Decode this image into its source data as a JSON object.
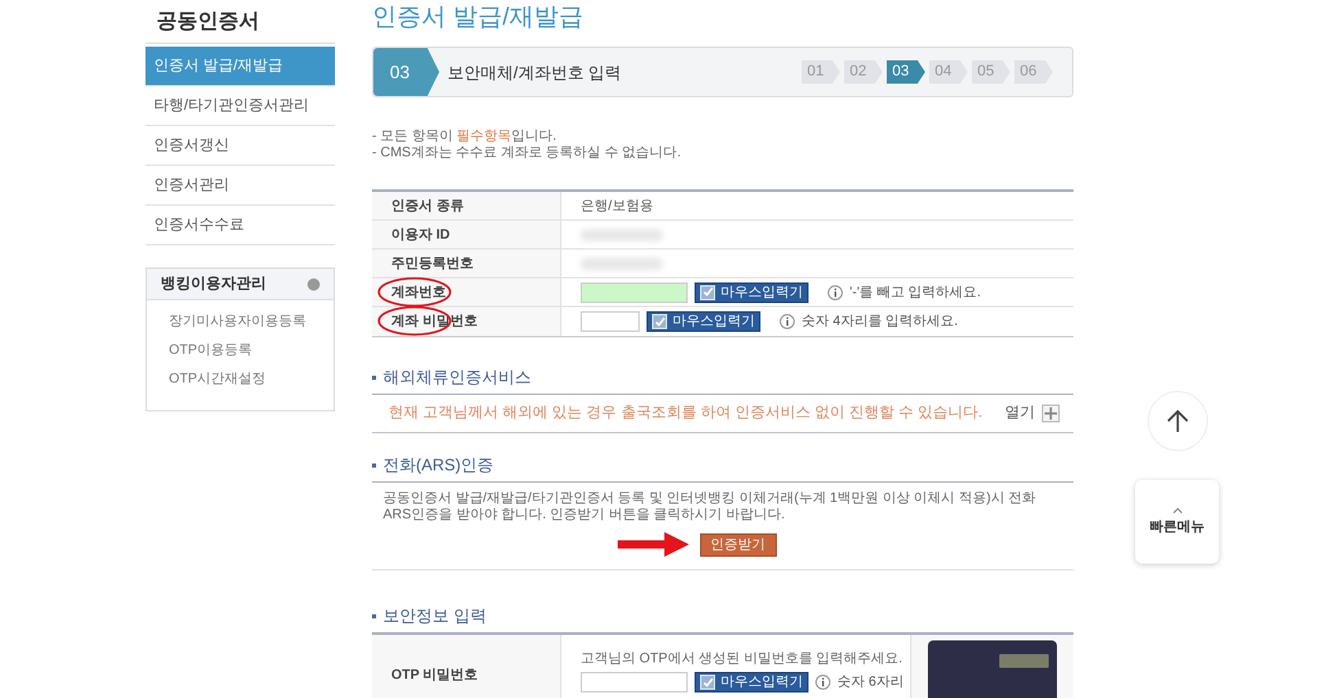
{
  "sidebar": {
    "title": "공동인증서",
    "items": [
      {
        "label": "인증서 발급/재발급",
        "selected": true
      },
      {
        "label": "타행/타기관인증서관리",
        "selected": false
      },
      {
        "label": "인증서갱신",
        "selected": false
      },
      {
        "label": "인증서관리",
        "selected": false
      },
      {
        "label": "인증서수수료",
        "selected": false
      }
    ],
    "box": {
      "title": "뱅킹이용자관리",
      "links": [
        "장기미사용자이용등록",
        "OTP이용등록",
        "OTP시간재설정"
      ]
    }
  },
  "page_title": "인증서 발급/재발급",
  "step_bar": {
    "current_number": "03",
    "current_label": "보안매체/계좌번호 입력",
    "steps": [
      {
        "label": "01",
        "selected": false
      },
      {
        "label": "02",
        "selected": false
      },
      {
        "label": "03",
        "selected": true
      },
      {
        "label": "04",
        "selected": false
      },
      {
        "label": "05",
        "selected": false
      },
      {
        "label": "06",
        "selected": false
      }
    ]
  },
  "notes": [
    [
      {
        "text": "- 모든 항목이 ",
        "highlight": false
      },
      {
        "text": "필수항목",
        "highlight": true
      },
      {
        "text": "입니다.",
        "highlight": false
      }
    ],
    [
      {
        "text": "- CMS계좌는 수수료 계좌로 등록하실 수 없습니다.",
        "highlight": false
      }
    ]
  ],
  "form": [
    {
      "label": "인증서 종류",
      "kind": "text",
      "value": "은행/보험용",
      "annotated": false
    },
    {
      "label": "이용자 ID",
      "kind": "hidden",
      "annotated": false
    },
    {
      "label": "주민등록번호",
      "kind": "hidden",
      "annotated": false
    },
    {
      "label": "계좌번호",
      "kind": "input",
      "wide": true,
      "active": true,
      "keypad": "마우스입력기",
      "keypad_checked": true,
      "hint": "'-'를 빼고 입력하세요.",
      "annotated": true
    },
    {
      "label": "계좌 비밀번호",
      "kind": "input",
      "wide": false,
      "active": false,
      "keypad": "마우스입력기",
      "keypad_checked": true,
      "hint": "숫자 4자리를 입력하세요.",
      "annotated": true
    }
  ],
  "overseas": {
    "heading": "해외체류인증서비스",
    "message": "현재 고객님께서 해외에 있는 경우 출국조회를 하여 인증서비스 없이 진행할 수 있습니다.",
    "toggle_label": "열기",
    "expanded": false
  },
  "ars": {
    "heading": "전화(ARS)인증",
    "text": "공동인증서 발급/재발급/타기관인증서 등록 및 인터넷뱅킹 이체거래(누계 1백만원 이상 이체시 적용)시 전화ARS인증을 받아야 합니다. 인증받기 버튼을 클릭하시기 바랍니다.",
    "button": "인증받기"
  },
  "security": {
    "heading": "보안정보 입력",
    "label": "OTP 비밀번호",
    "instruction": "고객님의 OTP에서 생성된 비밀번호를 입력해주세요.",
    "keypad": "마우스입력기",
    "keypad_checked": true,
    "hint": "숫자 6자리"
  },
  "quick_menu": {
    "label": "빠른메뉴"
  }
}
